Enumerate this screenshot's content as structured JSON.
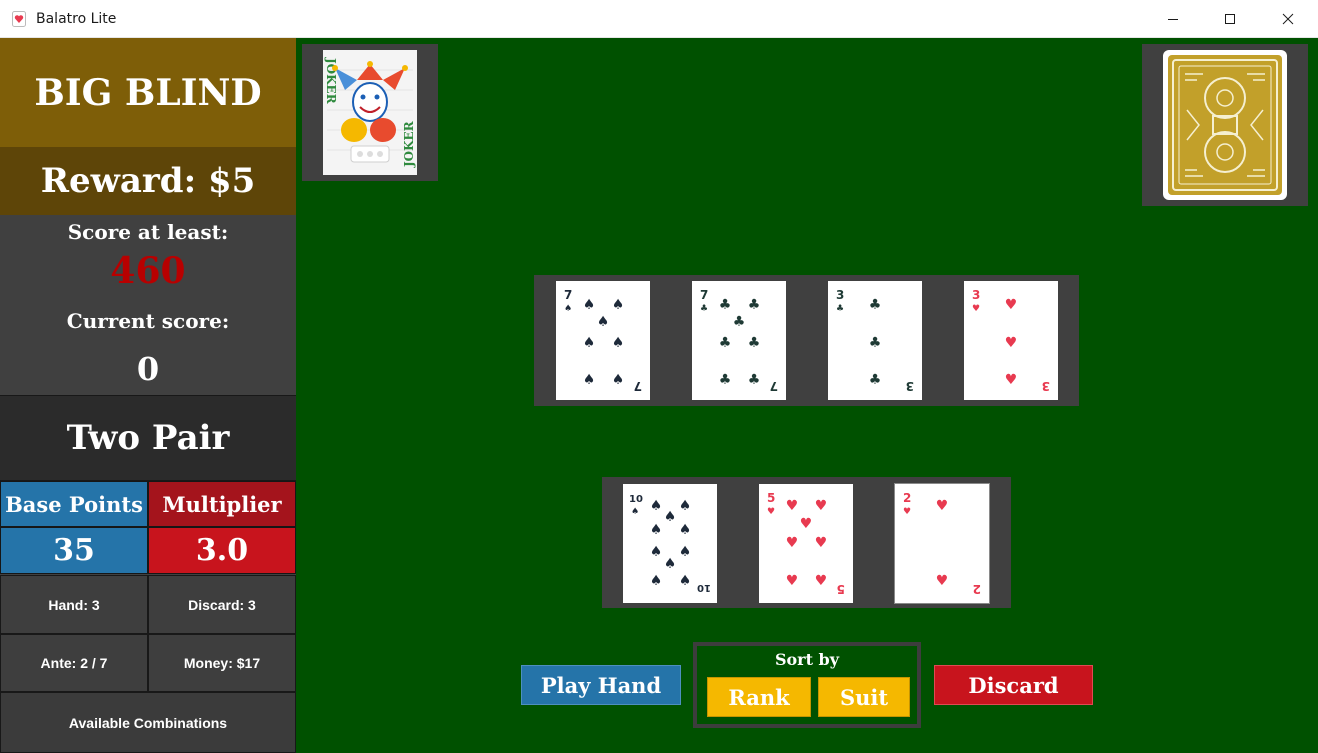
{
  "window": {
    "title": "Balatro Lite",
    "controls": [
      "minimize",
      "maximize",
      "close"
    ]
  },
  "sidebar": {
    "blind_name": "BIG BLIND",
    "reward": "Reward: $5",
    "score_label": "Score at least:",
    "score_target": "460",
    "current_label": "Current score:",
    "current_score": "0",
    "hand_type": "Two Pair",
    "base_points_label": "Base Points",
    "multiplier_label": "Multiplier",
    "base_points": "35",
    "multiplier": "3.0",
    "hands": "Hand: 3",
    "discards": "Discard: 3",
    "ante": "Ante: 2 / 7",
    "money": "Money: $17",
    "combos_button": "Available Combinations"
  },
  "joker": {
    "name": "JOKER"
  },
  "deck": {
    "label": "deck-back"
  },
  "selected_cards": [
    {
      "rank": "7",
      "suit": "spades"
    },
    {
      "rank": "7",
      "suit": "clubs"
    },
    {
      "rank": "3",
      "suit": "clubs"
    },
    {
      "rank": "3",
      "suit": "hearts"
    }
  ],
  "hand_cards": [
    {
      "rank": "10",
      "suit": "spades"
    },
    {
      "rank": "5",
      "suit": "hearts"
    },
    {
      "rank": "2",
      "suit": "hearts"
    }
  ],
  "controls": {
    "play_label": "Play Hand",
    "sort_label": "Sort by",
    "rank_label": "Rank",
    "suit_label": "Suit",
    "discard_label": "Discard"
  },
  "colors": {
    "table_green": "#005100",
    "blind_gold": "#7e5e08",
    "reward_brown": "#5e4508",
    "score_red": "#b80000",
    "chips_blue": "#2574a9",
    "mult_red": "#c8141d",
    "sort_yellow": "#f5b800",
    "discard_red": "#c8141d",
    "black_suit": "#1e2a3a",
    "red_suit": "#e83a50"
  }
}
